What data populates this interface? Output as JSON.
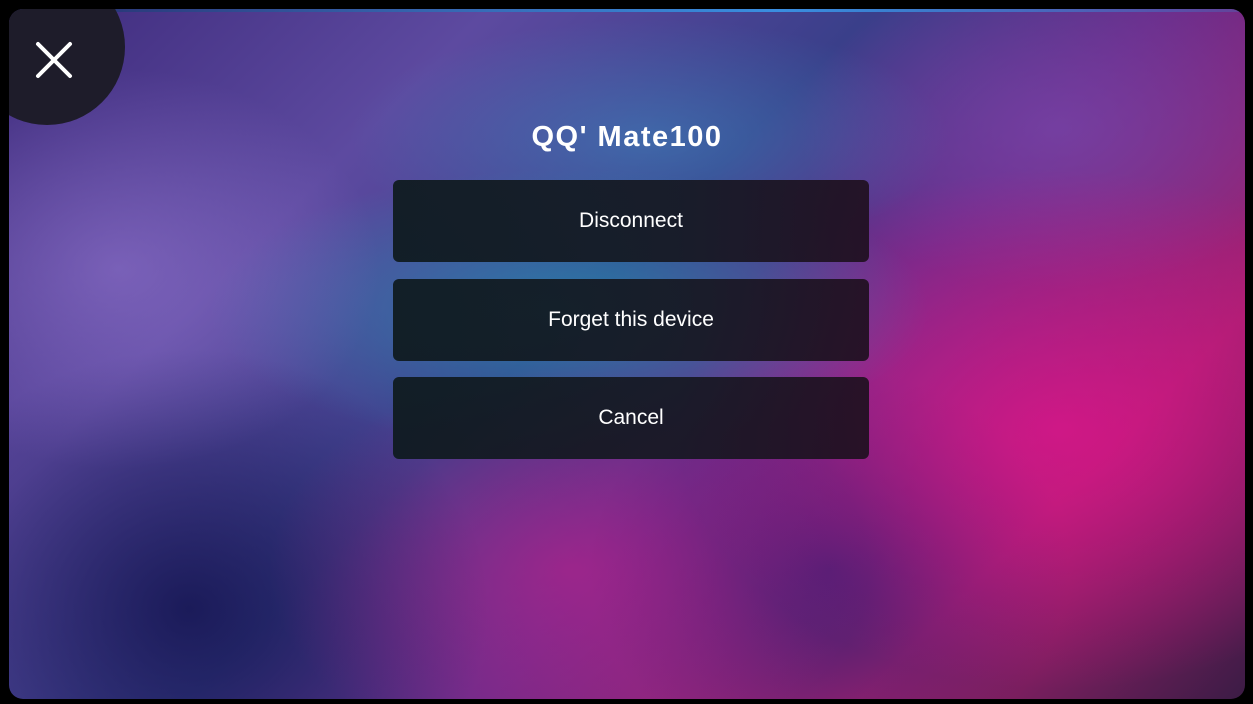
{
  "dialog": {
    "title": "QQ' Mate100",
    "close_icon": "close-icon",
    "buttons": [
      {
        "label": "Disconnect"
      },
      {
        "label": "Forget this device"
      },
      {
        "label": "Cancel"
      }
    ]
  },
  "colors": {
    "button_background": "#12181f",
    "text": "#ffffff",
    "close_background": "#1e1c2a"
  }
}
